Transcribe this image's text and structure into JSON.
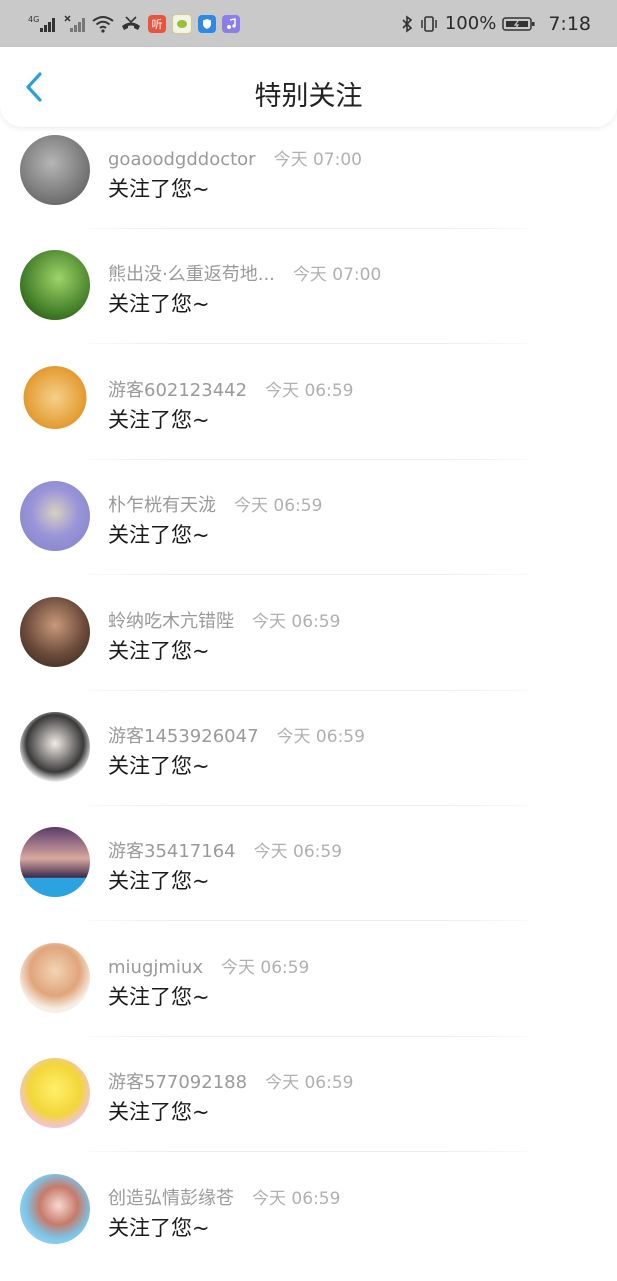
{
  "status_bar": {
    "network_label": "4G",
    "battery_text": "100%",
    "time": "7:18",
    "app_badge_label": "听"
  },
  "header": {
    "title": "特别关注"
  },
  "notifications": [
    {
      "username": "goaoodgddoctor",
      "time": "今天 07:00",
      "message": "关注了您~",
      "avatar_color": "#8e8e8e"
    },
    {
      "username": "熊出没·么重返苟地...",
      "time": "今天 07:00",
      "message": "关注了您~",
      "avatar_color": "#4f8a2e"
    },
    {
      "username": "游客602123442",
      "time": "今天 06:59",
      "message": "关注了您~",
      "avatar_color": "#e8a33c"
    },
    {
      "username": "朴乍桄有天泷",
      "time": "今天 06:59",
      "message": "关注了您~",
      "avatar_color": "#8f8fd8"
    },
    {
      "username": "蛉纳吃木亢错陛",
      "time": "今天 06:59",
      "message": "关注了您~",
      "avatar_color": "#6b4a3a"
    },
    {
      "username": "游客1453926047",
      "time": "今天 06:59",
      "message": "关注了您~",
      "avatar_color": "#3a3a3a"
    },
    {
      "username": "游客35417164",
      "time": "今天 06:59",
      "message": "关注了您~",
      "avatar_color": "#5a3a6a"
    },
    {
      "username": "miugjmiux",
      "time": "今天 06:59",
      "message": "关注了您~",
      "avatar_color": "#e9c7a8"
    },
    {
      "username": "游客577092188",
      "time": "今天 06:59",
      "message": "关注了您~",
      "avatar_color": "#f2d63a"
    },
    {
      "username": "创造弘情彭缘苍",
      "time": "今天 06:59",
      "message": "关注了您~",
      "avatar_color": "#7cc4e8"
    }
  ]
}
